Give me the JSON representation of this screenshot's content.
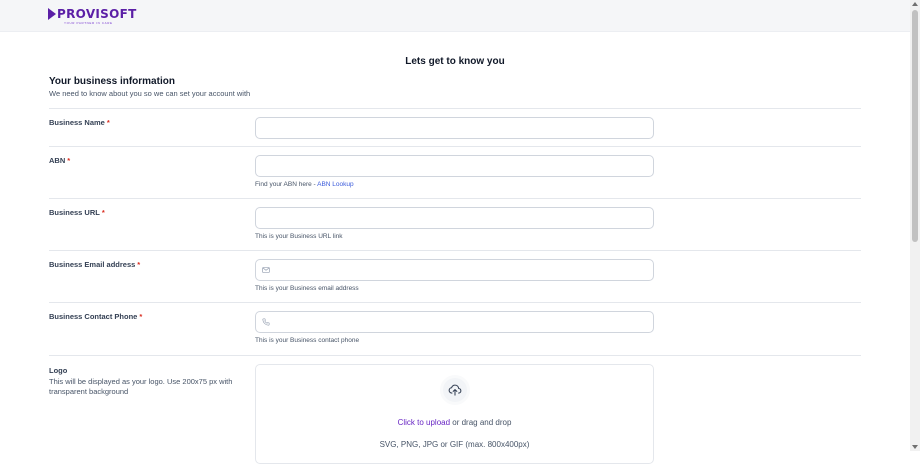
{
  "header": {
    "logo_text": "PROVISOFT",
    "logo_tagline": "YOUR PARTNER IN CARE"
  },
  "page": {
    "heading": "Lets get to know you"
  },
  "section": {
    "title": "Your business information",
    "subtitle": "We need to know about you so we can set your account with"
  },
  "fields": {
    "business_name": {
      "label": "Business Name",
      "required_mark": "*",
      "value": "",
      "placeholder": ""
    },
    "abn": {
      "label": "ABN",
      "required_mark": "*",
      "value": "",
      "placeholder": "",
      "hint_prefix": "Find your ABN here - ",
      "hint_link": "ABN Lookup"
    },
    "business_url": {
      "label": "Business URL",
      "required_mark": "*",
      "value": "",
      "placeholder": "",
      "hint": "This is your Business URL link"
    },
    "business_email": {
      "label": "Business Email address",
      "required_mark": "*",
      "value": "",
      "placeholder": "",
      "hint": "This is your Business email address",
      "icon": "mail-icon"
    },
    "business_phone": {
      "label": "Business Contact Phone",
      "required_mark": "*",
      "value": "",
      "placeholder": "",
      "hint": "This is your Business contact phone",
      "icon": "phone-icon"
    }
  },
  "logo": {
    "label": "Logo",
    "description": "This will be displayed as your logo. Use 200x75 px with transparent background",
    "upload_link": "Click to upload",
    "upload_suffix": " or drag and drop",
    "formats": "SVG, PNG, JPG or GIF (max. 800x400px)",
    "icon": "upload-cloud-icon"
  },
  "colors": {
    "brand": "#5b1fa6",
    "link": "#3b5bdb",
    "upload_link": "#6927c4",
    "required": "#d92d20"
  }
}
